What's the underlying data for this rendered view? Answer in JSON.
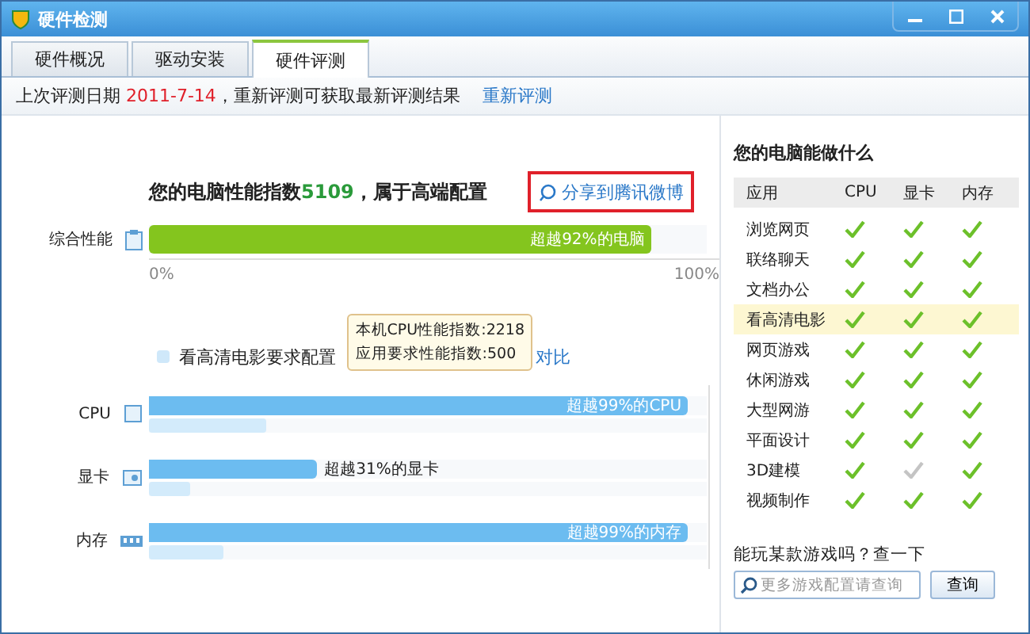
{
  "window": {
    "title": "硬件检测"
  },
  "tabs": [
    {
      "label": "硬件概况",
      "selected": false
    },
    {
      "label": "驱动安装",
      "selected": false
    },
    {
      "label": "硬件评测",
      "selected": true
    }
  ],
  "info_bar": {
    "prefix": "上次评测日期",
    "date": "2011-7-14",
    "suffix": "，重新评测可获取最新评测结果",
    "link": "重新评测"
  },
  "score": {
    "prefix": "您的电脑性能指数",
    "value": "5109",
    "suffix": "，属于高端配置",
    "share_link": "分享到腾讯微博"
  },
  "overall": {
    "label": "综合性能",
    "level": 0.9,
    "reading": "超越92%的电脑",
    "axis_min": "0%",
    "axis_max": "100%"
  },
  "legend": {
    "label": "看高清电影要求配置",
    "link_tail": "对比"
  },
  "tooltip": {
    "lines": [
      "本机CPU性能指数:2218",
      "应用要求性能指数:500"
    ]
  },
  "components": [
    {
      "label": "CPU",
      "kind": "cpu",
      "level": 0.966,
      "requirement": {
        "level": 0.21
      },
      "reading": "超越99%的CPU"
    },
    {
      "label": "显卡",
      "kind": "gpu",
      "level": 0.3,
      "requirement": {
        "level": 0.074
      },
      "reading": "超越31%的显卡"
    },
    {
      "label": "内存",
      "kind": "memory",
      "level": 0.966,
      "requirement": {
        "level": 0.134
      },
      "reading": "超越99%的内存"
    }
  ],
  "capabilities": {
    "title": "您的电脑能做什么",
    "columns": [
      "应用",
      "CPU",
      "显卡",
      "内存"
    ],
    "rows": [
      {
        "name": "浏览网页",
        "selected": false,
        "checks": [
          true,
          true,
          true
        ]
      },
      {
        "name": "联络聊天",
        "selected": false,
        "checks": [
          true,
          true,
          true
        ]
      },
      {
        "name": "文档办公",
        "selected": false,
        "checks": [
          true,
          true,
          true
        ]
      },
      {
        "name": "看高清电影",
        "selected": true,
        "checks": [
          true,
          true,
          true
        ]
      },
      {
        "name": "网页游戏",
        "selected": false,
        "checks": [
          true,
          true,
          true
        ]
      },
      {
        "name": "休闲游戏",
        "selected": false,
        "checks": [
          true,
          true,
          true
        ]
      },
      {
        "name": "大型网游",
        "selected": false,
        "checks": [
          true,
          true,
          true
        ]
      },
      {
        "name": "平面设计",
        "selected": false,
        "checks": [
          true,
          true,
          true
        ]
      },
      {
        "name": "3D建模",
        "selected": false,
        "checks": [
          true,
          false,
          true
        ]
      },
      {
        "name": "视频制作",
        "selected": false,
        "checks": [
          true,
          true,
          true
        ]
      }
    ]
  },
  "game_query": {
    "label": "能玩某款游戏吗？查一下",
    "placeholder": "更多游戏配置请查询",
    "button": "查询"
  }
}
